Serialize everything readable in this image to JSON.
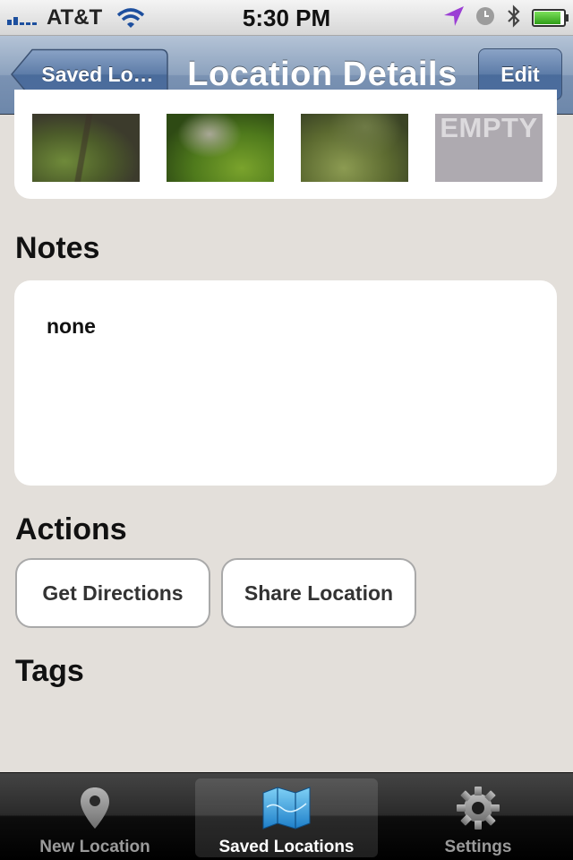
{
  "status_bar": {
    "carrier": "AT&T",
    "time": "5:30 PM",
    "icons": [
      "signal-icon",
      "wifi-icon",
      "location-arrow-icon",
      "alarm-clock-icon",
      "bluetooth-icon",
      "battery-icon"
    ],
    "battery_level": 0.85
  },
  "nav": {
    "back_label": "Saved Lo…",
    "title": "Location Details",
    "edit_label": "Edit"
  },
  "photos": {
    "empty_label": "EMPTY"
  },
  "notes": {
    "heading": "Notes",
    "text": "none"
  },
  "actions": {
    "heading": "Actions",
    "get_directions": "Get Directions",
    "share_location": "Share Location"
  },
  "tags": {
    "heading": "Tags"
  },
  "tabbar": {
    "tabs": [
      {
        "label": "New Location",
        "icon": "map-pin-icon",
        "selected": false
      },
      {
        "label": "Saved Locations",
        "icon": "folded-map-icon",
        "selected": true
      },
      {
        "label": "Settings",
        "icon": "gear-icon",
        "selected": false
      }
    ]
  },
  "colors": {
    "nav_bar": "#7a92b3",
    "background": "#e3dfda",
    "selected_tab_label": "#ffffff",
    "unselected_tab_label": "#9a9a9a"
  }
}
